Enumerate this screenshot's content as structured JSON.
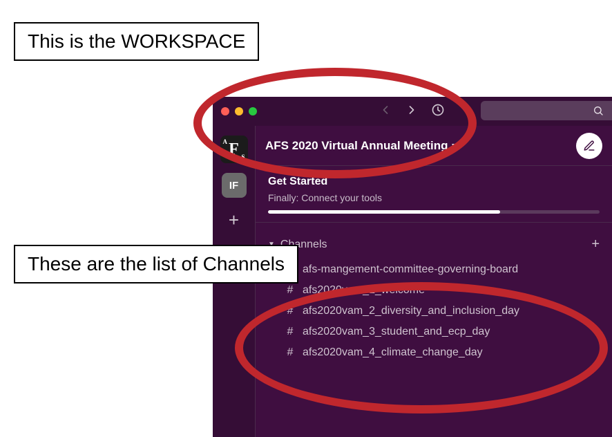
{
  "annotations": {
    "workspace_label": "This is the WORKSPACE",
    "channels_label": "These are the list of Channels"
  },
  "left_col": {
    "ws_icon": {
      "big": "F",
      "corner_a": "A",
      "corner_s": "S"
    },
    "user_badge": "IF",
    "add_label": "+"
  },
  "workspace": {
    "name": "AFS 2020 Virtual Annual Meeting"
  },
  "get_started": {
    "title": "Get Started",
    "subtitle": "Finally: Connect your tools"
  },
  "channels_section": {
    "header": "Channels",
    "add_label": "+",
    "items": [
      {
        "prefix_icon": "lock",
        "name": "afs-mangement-committee-governing-board"
      },
      {
        "prefix_icon": "hash",
        "name": "afs2020vam_1_welcome"
      },
      {
        "prefix_icon": "hash",
        "name": "afs2020vam_2_diversity_and_inclusion_day"
      },
      {
        "prefix_icon": "hash",
        "name": "afs2020vam_3_student_and_ecp_day"
      },
      {
        "prefix_icon": "hash",
        "name": "afs2020vam_4_climate_change_day"
      }
    ]
  }
}
